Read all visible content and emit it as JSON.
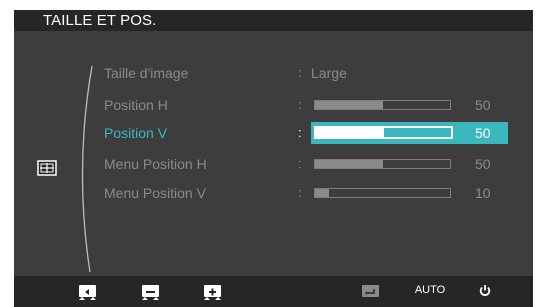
{
  "menu": {
    "title": "TAILLE ET POS.",
    "side_icon": "position-grid-icon",
    "items": [
      {
        "label": "Taille d'image",
        "colon": ":",
        "value": "Large"
      },
      {
        "label": "Position H",
        "colon": ":",
        "level": 0.5,
        "value": "50"
      },
      {
        "label": "Position V",
        "colon": ":",
        "level": 0.5,
        "value": "50"
      },
      {
        "label": "Menu Position H",
        "colon": ":",
        "level": 0.5,
        "value": "50"
      },
      {
        "label": "Menu Position V",
        "colon": ":",
        "level": 0.1,
        "value": "10"
      }
    ],
    "selected_index": 2
  },
  "buttons": {
    "left": "left-arrow-icon",
    "minus": "minus-icon",
    "plus": "plus-icon",
    "enter": "enter-icon",
    "auto_label": "AUTO",
    "power": "power-icon"
  },
  "colors": {
    "accent": "#3ab7bd",
    "background": "#3d3d3d",
    "bar": "#262626",
    "text_dim": "#8a8a8a",
    "text_bright": "#ffffff"
  }
}
